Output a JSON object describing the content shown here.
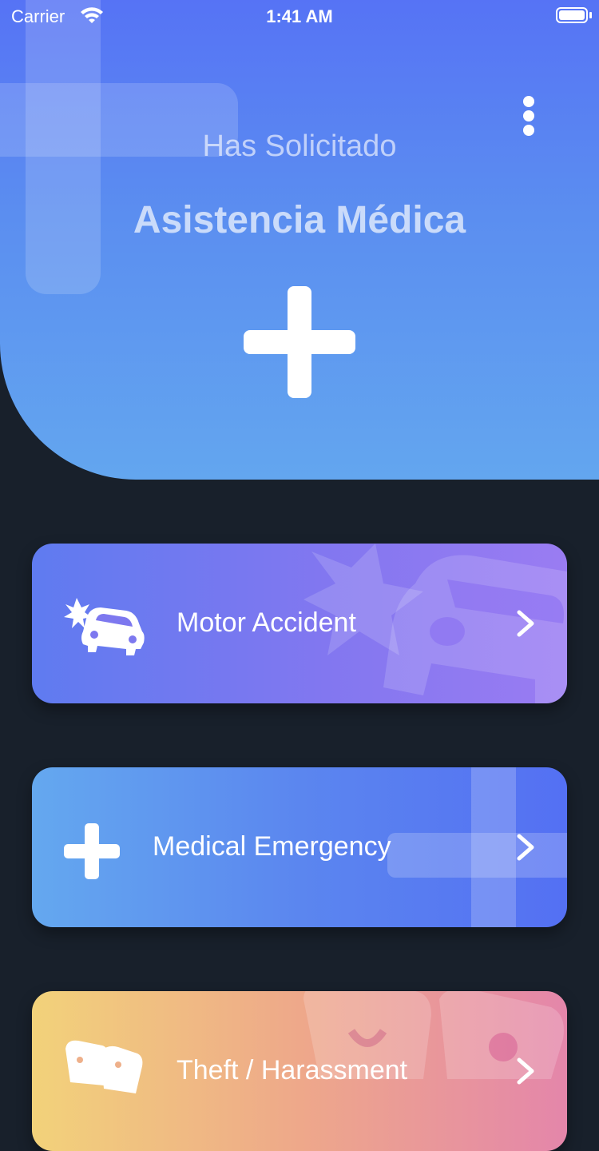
{
  "status_bar": {
    "carrier": "Carrier",
    "time": "1:41 AM"
  },
  "header": {
    "subtitle": "Has Solicitado",
    "title": "Asistencia Médica",
    "icon": "plus-icon",
    "gradient": [
      "#5673f5",
      "#63a6ef"
    ]
  },
  "cards": [
    {
      "label": "Motor Accident",
      "icon": "car-crash-icon"
    },
    {
      "label": "Medical Emergency",
      "icon": "plus-icon"
    },
    {
      "label": "Theft / Harassment",
      "icon": "mask-icon"
    }
  ],
  "colors": {
    "background": "#18202b"
  }
}
